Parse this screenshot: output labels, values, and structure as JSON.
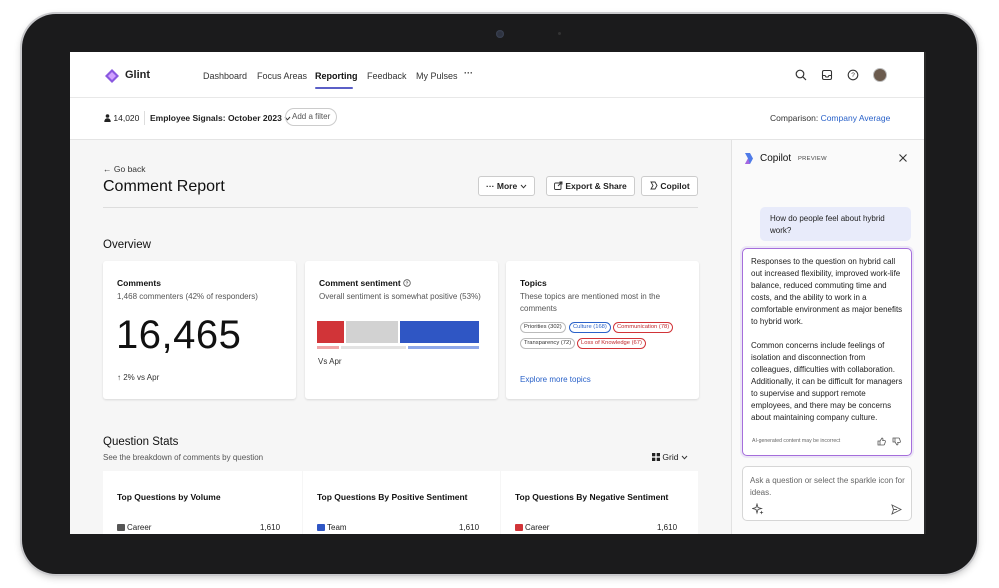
{
  "app": {
    "brand": "Glint"
  },
  "nav": {
    "items": [
      "Dashboard",
      "Focus Areas",
      "Reporting",
      "Feedback",
      "My Pulses"
    ],
    "more": "···",
    "active": "Reporting"
  },
  "filters": {
    "people_count": "14,020",
    "survey": "Employee Signals: October 2023",
    "add_filter": "Add a filter",
    "comparison_label": "Comparison:",
    "comparison_value": "Company Average"
  },
  "page": {
    "go_back": "Go back",
    "title": "Comment Report",
    "buttons": {
      "more": "More",
      "export": "Export & Share",
      "copilot": "Copilot"
    }
  },
  "overview": {
    "title": "Overview",
    "comments": {
      "title": "Comments",
      "subtitle": "1,468 commenters (42% of responders)",
      "value": "16,465",
      "delta": "2% vs Apr"
    },
    "sentiment": {
      "title": "Comment sentiment",
      "subtitle": "Overall sentiment is somewhat positive (53%)",
      "compare_label": "Vs Apr",
      "segments": [
        {
          "name": "negative",
          "fraction": 0.17,
          "color": "#d13438"
        },
        {
          "name": "neutral",
          "fraction": 0.33,
          "color": "#d2d2d2"
        },
        {
          "name": "positive",
          "fraction": 0.5,
          "color": "#2f56c4"
        }
      ],
      "previous_segments": [
        {
          "name": "negative",
          "fraction": 0.14,
          "color": "#f1a6a8"
        },
        {
          "name": "neutral",
          "fraction": 0.41,
          "color": "#e3e3e3"
        },
        {
          "name": "positive",
          "fraction": 0.45,
          "color": "#8ea8ea"
        }
      ]
    },
    "topics": {
      "title": "Topics",
      "subtitle": "These topics are mentioned most in the comments",
      "chips": [
        {
          "label": "Priorities (302)",
          "tone": "neutral"
        },
        {
          "label": "Culture (168)",
          "tone": "positive"
        },
        {
          "label": "Communication (78)",
          "tone": "negative"
        },
        {
          "label": "Transparency (72)",
          "tone": "neutral"
        },
        {
          "label": "Loss of Knowledge (67)",
          "tone": "negative"
        }
      ],
      "explore": "Explore more topics"
    }
  },
  "question_stats": {
    "title": "Question Stats",
    "subtitle": "See the breakdown of comments by question",
    "view_toggle": "Grid",
    "cards": [
      {
        "title": "Top Questions by Volume",
        "row_label": "Career",
        "row_value": "1,610",
        "icon_color": "#555555"
      },
      {
        "title": "Top Questions By Positive Sentiment",
        "row_label": "Team",
        "row_value": "1,610",
        "icon_color": "#2f56c4"
      },
      {
        "title": "Top Questions By Negative Sentiment",
        "row_label": "Career",
        "row_value": "1,610",
        "icon_color": "#d13438"
      }
    ]
  },
  "copilot": {
    "title": "Copilot",
    "badge": "PREVIEW",
    "user_message": "How do people feel about hybrid work?",
    "ai_paragraphs": [
      "Responses to the question on hybrid call out increased flexibility, improved work-life balance, reduced commuting time and costs, and the ability to work in a comfortable environment as major benefits to hybrid work.",
      "Common concerns include feelings of isolation and disconnection from colleagues, difficulties with collaboration. Additionally, it can be difficult for managers to supervise and support remote employees, and there may be concerns about maintaining company culture."
    ],
    "disclaimer": "AI-generated content may be incorrect",
    "input_placeholder": "Ask a question or select the sparkle icon for ideas."
  },
  "colors": {
    "accent": "#5b5fc7",
    "link": "#2a62c9",
    "copilot_border": "#a56edb"
  }
}
